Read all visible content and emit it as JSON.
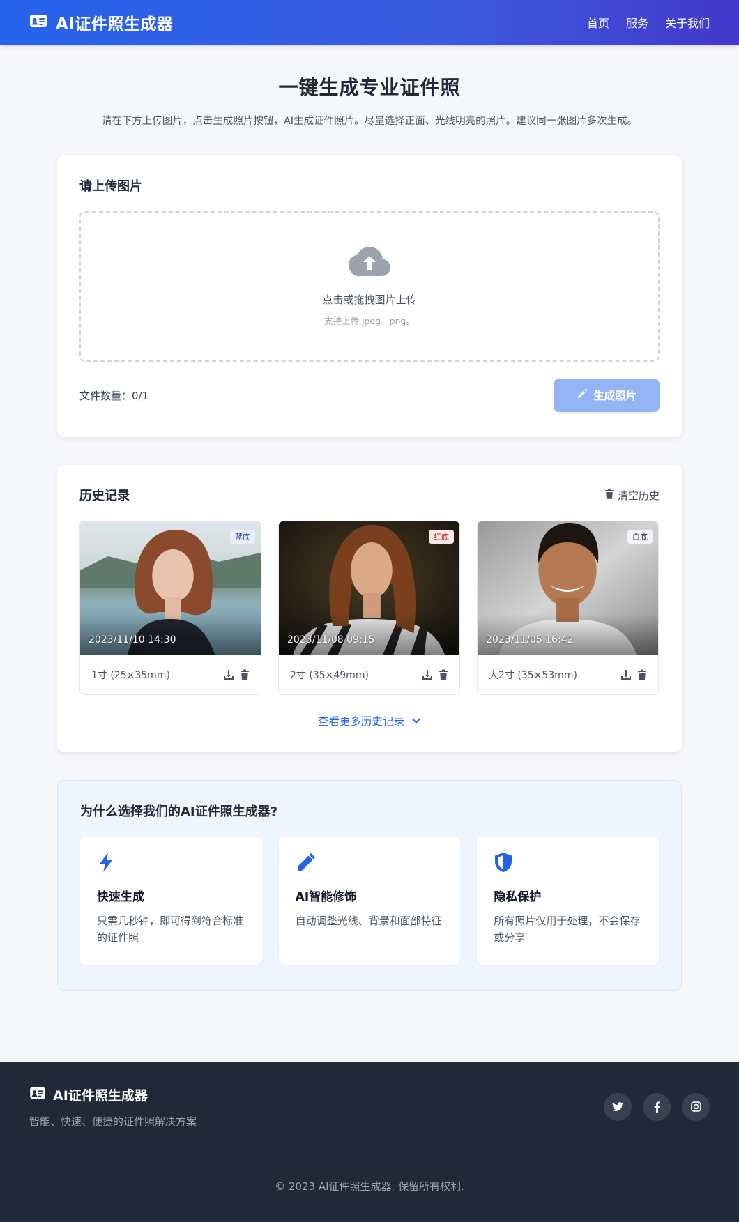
{
  "header": {
    "brand_icon": "id-card-icon",
    "title": "AI证件照生成器",
    "nav": [
      "首页",
      "服务",
      "关于我们"
    ]
  },
  "hero": {
    "title": "一键生成专业证件照",
    "subtitle": "请在下方上传图片，点击生成照片按钮，AI生成证件照片。尽量选择正面、光线明亮的照片。建议同一张图片多次生成。"
  },
  "upload": {
    "title": "请上传图片",
    "icon": "cloud-upload-icon",
    "main_text": "点击或拖拽图片上传",
    "sub_text": "支持上传 jpeg、png。",
    "file_count": "文件数量：0/1",
    "generate_label": "生成照片",
    "generate_icon": "pencil-icon"
  },
  "history": {
    "title": "历史记录",
    "clear_label": "清空历史",
    "items": [
      {
        "badge": "蓝底",
        "date": "2023/11/10 14:30",
        "size": "1寸 (25×35mm)"
      },
      {
        "badge": "红底",
        "date": "2023/11/08 09:15",
        "size": "2寸 (35×49mm)"
      },
      {
        "badge": "白底",
        "date": "2023/11/05 16:42",
        "size": "大2寸 (35×53mm)"
      }
    ],
    "more_label": "查看更多历史记录"
  },
  "features": {
    "title": "为什么选择我们的AI证件照生成器?",
    "items": [
      {
        "icon": "bolt-icon",
        "title": "快速生成",
        "desc": "只需几秒钟，即可得到符合标准的证件照"
      },
      {
        "icon": "magic-wand-icon",
        "title": "AI智能修饰",
        "desc": "自动调整光线、背景和面部特征"
      },
      {
        "icon": "shield-icon",
        "title": "隐私保护",
        "desc": "所有照片仅用于处理，不会保存或分享"
      }
    ]
  },
  "footer": {
    "title": "AI证件照生成器",
    "tagline": "智能、快速、便捷的证件照解决方案",
    "socials": [
      "twitter-icon",
      "facebook-icon",
      "instagram-icon"
    ],
    "copyright": "© 2023 AI证件照生成器. 保留所有权利."
  },
  "colors": {
    "primary": "#2563eb",
    "button_disabled": "#93b4f5",
    "footer_bg": "#1f2937",
    "badge_blue": "#e8eefc",
    "badge_red": "#fde8e8",
    "badge_white": "#f3f4f6"
  }
}
